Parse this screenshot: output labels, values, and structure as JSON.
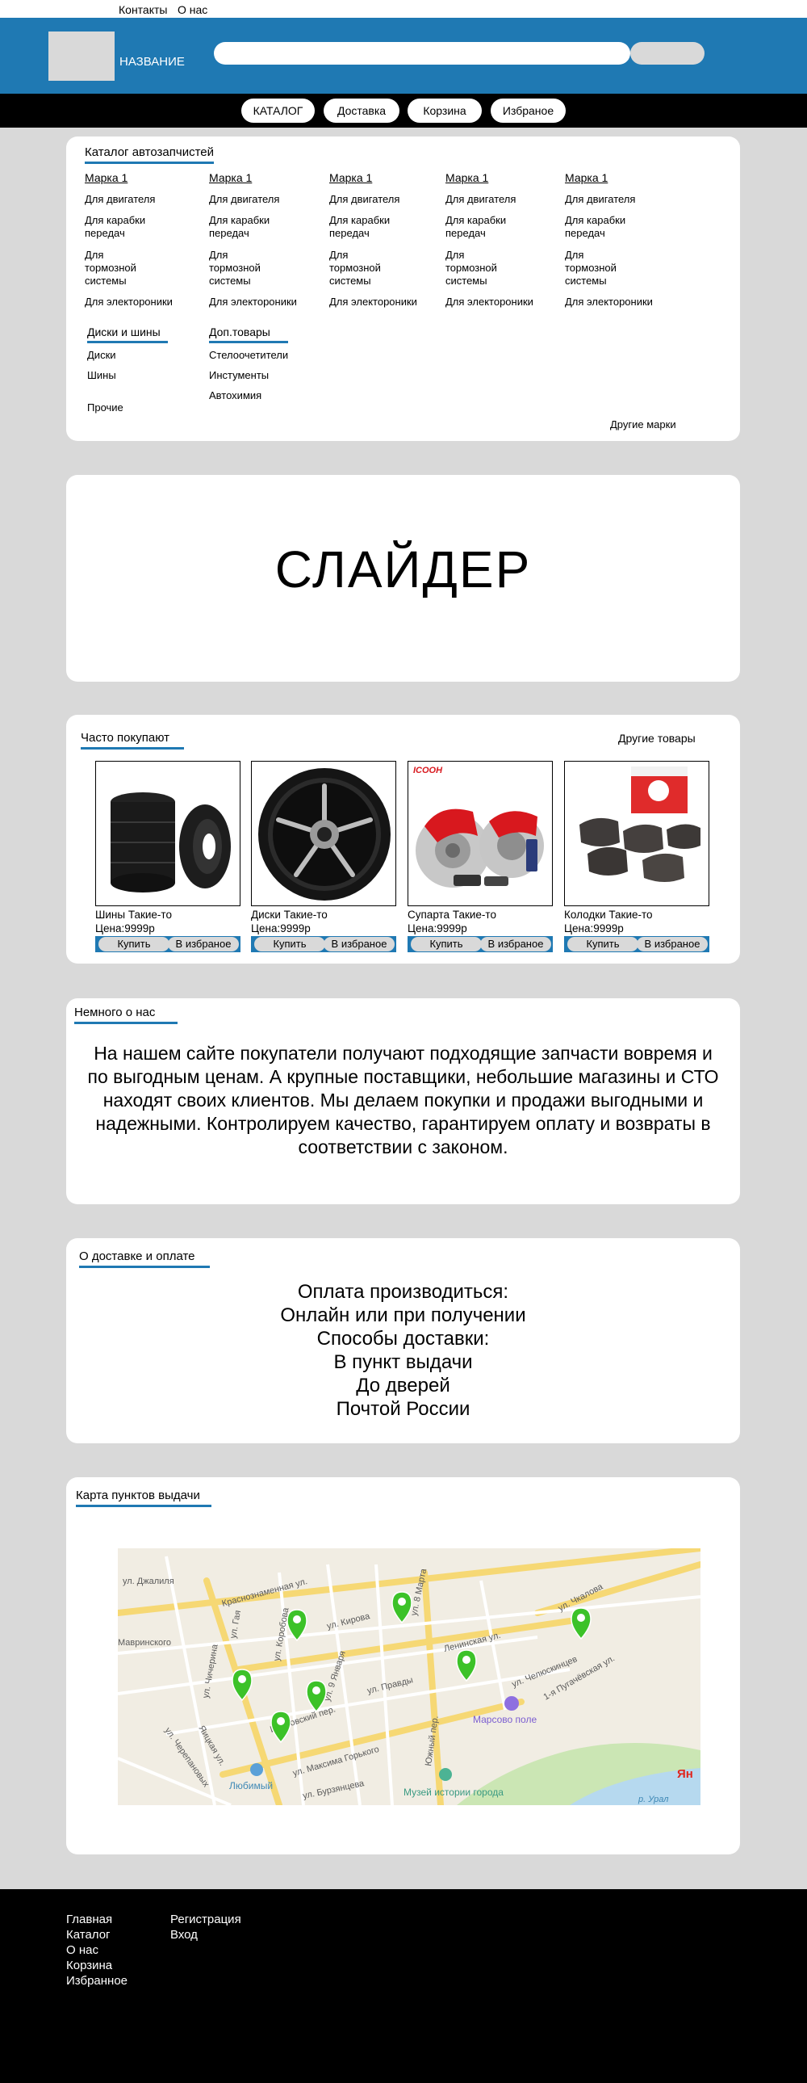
{
  "topbar": {
    "contacts": "Контакты",
    "about": "О нас"
  },
  "header": {
    "site_name": "НАЗВАНИЕ"
  },
  "nav": {
    "catalog": "КАТАЛОГ",
    "delivery": "Доставка",
    "cart": "Корзина",
    "favorites": "Избраное"
  },
  "catalog": {
    "title": "Каталог автозапчистей",
    "brands": [
      {
        "name": "Марка 1",
        "items": [
          "Для двигателя",
          "Для карабки передач",
          "Для тормозной системы",
          "Для электороники"
        ]
      },
      {
        "name": "Марка 1",
        "items": [
          "Для двигателя",
          "Для карабки передач",
          "Для тормозной системы",
          "Для электороники"
        ]
      },
      {
        "name": "Марка 1",
        "items": [
          "Для двигателя",
          "Для карабки передач",
          "Для тормозной системы",
          "Для электороники"
        ]
      },
      {
        "name": "Марка 1",
        "items": [
          "Для двигателя",
          "Для карабки передач",
          "Для тормозной системы",
          "Для электороники"
        ]
      },
      {
        "name": "Марка 1",
        "items": [
          "Для двигателя",
          "Для карабки передач",
          "Для тормозной системы",
          "Для электороники"
        ]
      }
    ],
    "wheels_title": "Диски и шины",
    "wheels": [
      "Диски",
      "Шины",
      "Прочие"
    ],
    "extra_title": "Доп.товары",
    "extra": [
      "Стелоочетители",
      "Инстументы",
      "Автохимия"
    ],
    "other_brands": "Другие марки"
  },
  "slider": {
    "text": "СЛАЙДЕР"
  },
  "popular": {
    "title": "Часто покупают",
    "other": "Другие товары",
    "products": [
      {
        "name": "Шины Такие-то",
        "price": "Цена:9999р",
        "buy": "Купить",
        "fav": "В избраное",
        "icon": "tires-image"
      },
      {
        "name": "Диски Такие-то",
        "price": "Цена:9999р",
        "buy": "Купить",
        "fav": "В избраное",
        "icon": "wheel-disk-image"
      },
      {
        "name": "Супарта Такие-то",
        "price": "Цена:9999р",
        "buy": "Купить",
        "fav": "В избраное",
        "icon": "brake-caliper-image"
      },
      {
        "name": "Колодки Такие-то",
        "price": "Цена:9999р",
        "buy": "Купить",
        "fav": "В избраное",
        "icon": "brake-pads-image"
      }
    ]
  },
  "about": {
    "title": "Немного о нас",
    "text": "На нашем сайте покупатели получают подходящие запчасти вовремя и по выгодным ценам. А крупные поставщики, небольшие магазины и СТО находят своих клиентов. Мы делаем покупки и продажи выгодными и надежными. Контролируем качество, гарантируем оплату и возвраты в соответствии с законом."
  },
  "delivery": {
    "title": "О доставке и оплате",
    "lines": [
      "Оплата производиться:",
      "Онлайн или при получении",
      "Способы доставки:",
      "В пункт выдачи",
      "До дверей",
      "Почтой России"
    ]
  },
  "map": {
    "title": "Карта пунктов выдачи",
    "streets": [
      "ул. Джалиля",
      "Краснознаменная ул.",
      "ул. 8 Марта",
      "ул. Чкалова",
      "ул. Кирова",
      "Ленинская ул.",
      "ул. Коробова",
      "ул. Гая",
      "ул. Чичерина",
      "ул. 9 Января",
      "ул. Правды",
      "ул. Челюскинцев",
      "1-я Пугачёвская ул.",
      "Мавринского",
      "Ивановский пер.",
      "Южный пер.",
      "Марсово поле",
      "ул. Максима Горького",
      "Яицкая ул.",
      "ул. Черепановых",
      "ул. Бурзянцева",
      "Любимый",
      "Музей истории города",
      "р. Урал",
      "Ян"
    ],
    "pins": 7
  },
  "footer": {
    "col1": [
      "Главная",
      "Каталог",
      "О нас",
      "Корзина",
      "Избранное"
    ],
    "col2": [
      "Регистрация",
      "Вход"
    ]
  },
  "colors": {
    "accent": "#1f79b3",
    "background": "#d9d9d9",
    "dark": "#000000"
  }
}
